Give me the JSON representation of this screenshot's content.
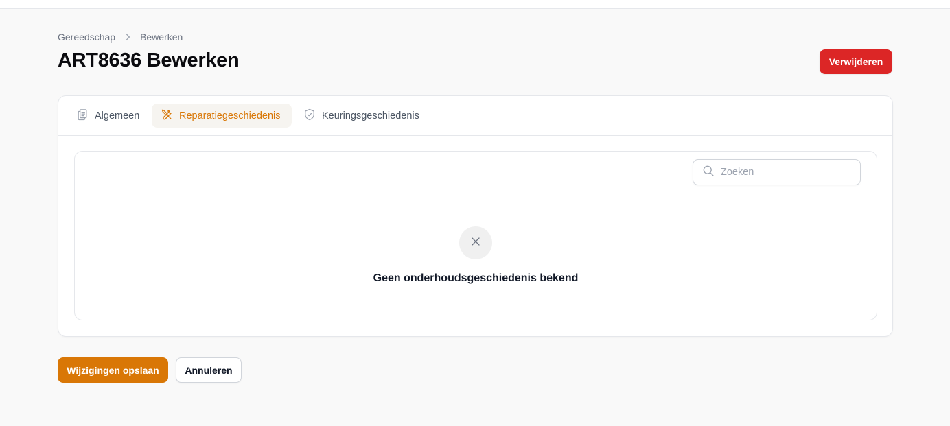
{
  "breadcrumb": {
    "items": [
      "Gereedschap",
      "Bewerken"
    ]
  },
  "header": {
    "title": "ART8636 Bewerken",
    "delete_label": "Verwijderen"
  },
  "tabs": [
    {
      "label": "Algemeen",
      "icon": "clipboard-document-icon",
      "active": false
    },
    {
      "label": "Reparatiegeschiedenis",
      "icon": "wrench-screwdriver-icon",
      "active": true
    },
    {
      "label": "Keuringsgeschiedenis",
      "icon": "shield-check-icon",
      "active": false
    }
  ],
  "table": {
    "search_placeholder": "Zoeken",
    "empty_icon": "x-mark-icon",
    "empty_text": "Geen onderhoudsgeschiedenis bekend"
  },
  "actions": {
    "save_label": "Wijzigingen opslaan",
    "cancel_label": "Annuleren"
  },
  "colors": {
    "accent": "#d97706",
    "danger": "#dc2626"
  }
}
